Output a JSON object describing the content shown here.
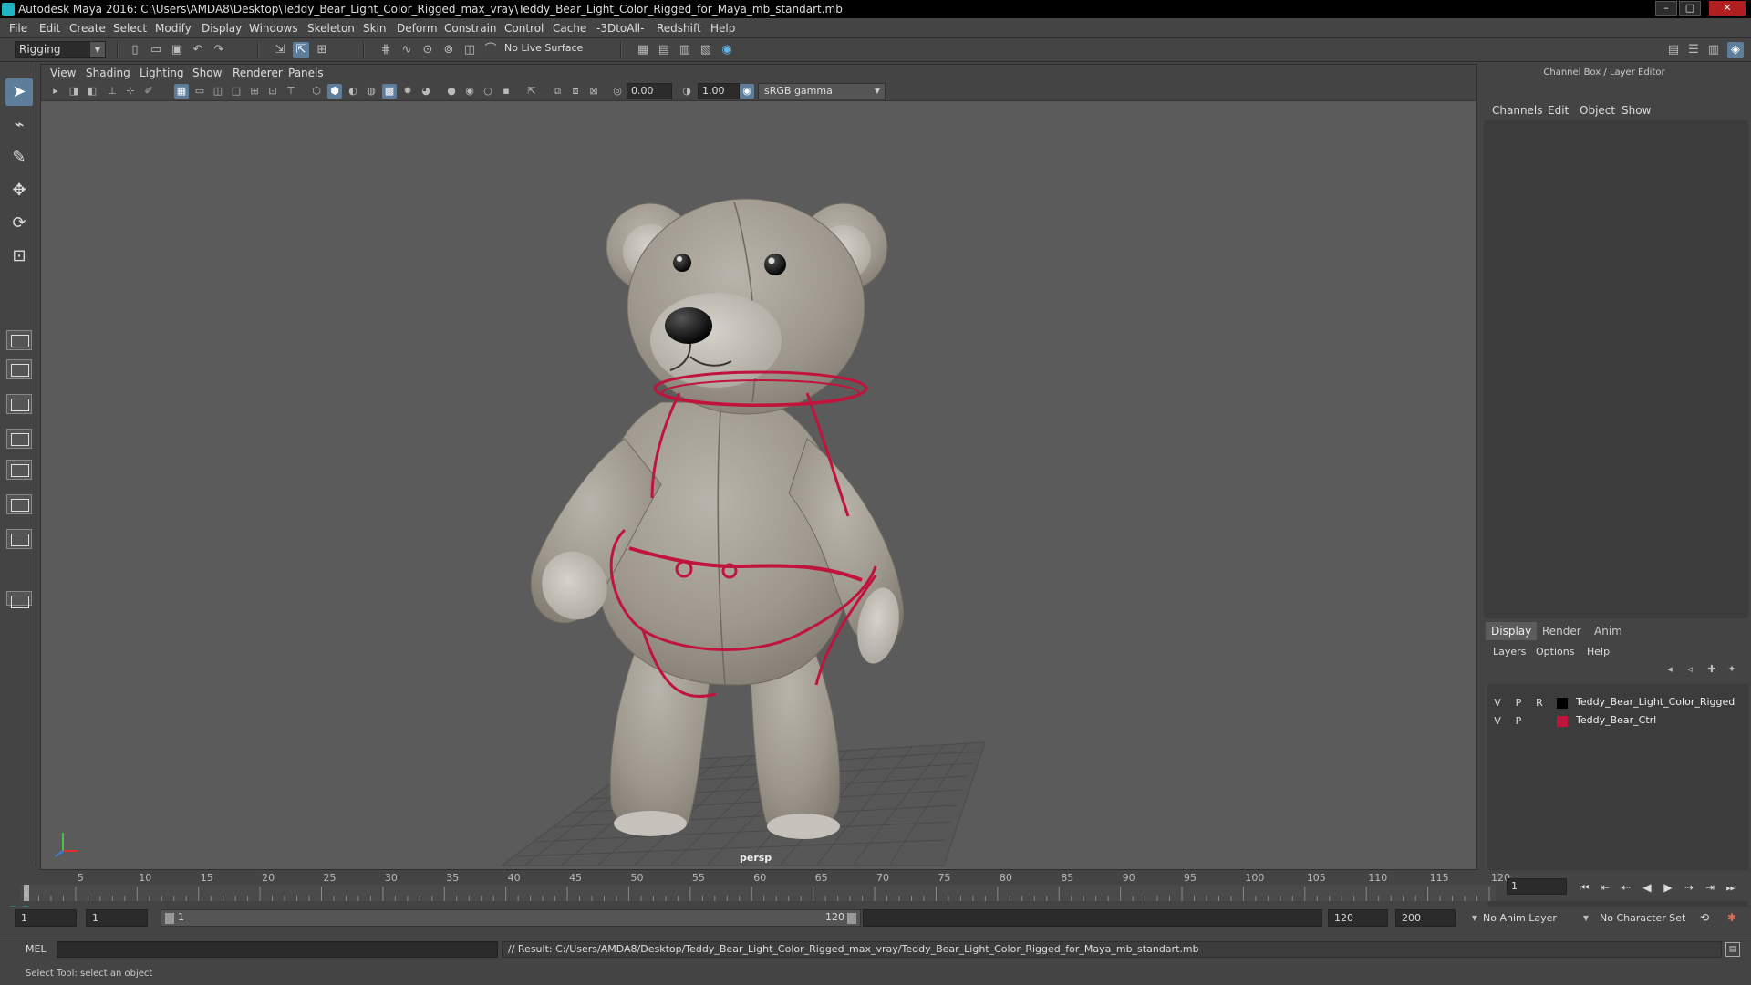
{
  "window": {
    "title": "Autodesk Maya 2016: C:\\Users\\AMDA8\\Desktop\\Teddy_Bear_Light_Color_Rigged_max_vray\\Teddy_Bear_Light_Color_Rigged_for_Maya_mb_standart.mb",
    "controls": {
      "minimize": "–",
      "maximize": "□",
      "close": "✕"
    }
  },
  "menubar": {
    "items": [
      "File",
      "Edit",
      "Create",
      "Select",
      "Modify",
      "Display",
      "Windows",
      "Skeleton",
      "Skin",
      "Deform",
      "Constrain",
      "Control",
      "Cache",
      "-3DtoAll-",
      "Redshift",
      "Help"
    ]
  },
  "shelf": {
    "mode": "Rigging",
    "live_surface": "No Live Surface"
  },
  "viewport": {
    "panel_menu": [
      "View",
      "Shading",
      "Lighting",
      "Show",
      "Renderer",
      "Panels"
    ],
    "exposure": "0.00",
    "gamma": "1.00",
    "color_space": "sRGB gamma",
    "camera": "persp"
  },
  "channel_box": {
    "title": "Channel Box / Layer Editor",
    "menu": [
      "Channels",
      "Edit",
      "Object",
      "Show"
    ]
  },
  "layer_editor": {
    "tabs": [
      "Display",
      "Render",
      "Anim"
    ],
    "active_tab": "Display",
    "menu": [
      "Layers",
      "Options",
      "Help"
    ],
    "layers": [
      {
        "v": "V",
        "p": "P",
        "r": "R",
        "color": "#000000",
        "name": "Teddy_Bear_Light_Color_Rigged"
      },
      {
        "v": "V",
        "p": "P",
        "r": "",
        "color": "#c0143c",
        "name": "Teddy_Bear_Ctrl"
      }
    ]
  },
  "timeline": {
    "tick_labels": [
      "1",
      "5",
      "10",
      "15",
      "20",
      "25",
      "30",
      "35",
      "40",
      "45",
      "50",
      "55",
      "60",
      "65",
      "70",
      "75",
      "80",
      "85",
      "90",
      "95",
      "100",
      "105",
      "110",
      "115",
      "120"
    ],
    "current_frame": "1"
  },
  "range": {
    "start": "1",
    "playback_start": "1",
    "bar_start_label": "1",
    "bar_end_label": "120",
    "playback_end": "120",
    "end": "200",
    "anim_layer": "No Anim Layer",
    "character_set": "No Character Set"
  },
  "command": {
    "language": "MEL",
    "result": "// Result: C:/Users/AMDA8/Desktop/Teddy_Bear_Light_Color_Rigged_max_vray/Teddy_Bear_Light_Color_Rigged_for_Maya_mb_standart.mb"
  },
  "help_line": "Select Tool: select an object",
  "colors": {
    "accent": "#5d7d9a",
    "rig_controls": "#c0143c",
    "maya_teal": "#1fb5c4"
  }
}
